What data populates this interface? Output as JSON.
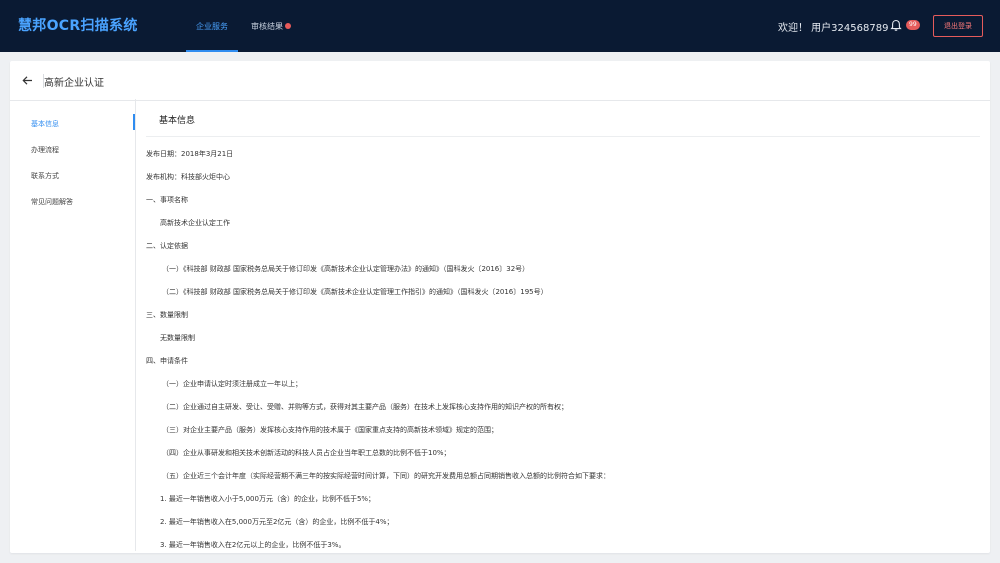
{
  "app": {
    "title": "慧邦OCR扫描系统"
  },
  "nav": {
    "tabs": [
      {
        "label": "企业服务"
      },
      {
        "label": "审核结果"
      }
    ]
  },
  "user": {
    "welcome": "欢迎！ 用户324568789",
    "notifications": "99",
    "logout_label": "退出登录"
  },
  "page": {
    "title": "高新企业认证"
  },
  "sidebar": {
    "items": [
      {
        "label": "基本信息"
      },
      {
        "label": "办理流程"
      },
      {
        "label": "联系方式"
      },
      {
        "label": "常见问题解答"
      }
    ]
  },
  "content": {
    "section_title": "基本信息",
    "lines": [
      "发布日期：2018年3月21日",
      "发布机构：科技部火炬中心",
      "一、事项名称",
      "高新技术企业认定工作",
      "二、认定依据",
      "（一）《科技部  财政部  国家税务总局关于修订印发《高新技术企业认定管理办法》的通知》（国科发火〔2016〕32号）",
      "（二）《科技部  财政部  国家税务总局关于修订印发《高新技术企业认定管理工作指引》的通知》（国科发火〔2016〕195号）",
      "三、数量限制",
      "无数量限制",
      "四、申请条件",
      "（一）企业申请认定时须注册成立一年以上；",
      "（二）企业通过自主研发、受让、受赠、并购等方式，获得对其主要产品（服务）在技术上发挥核心支持作用的知识产权的所有权；",
      "（三）对企业主要产品（服务）发挥核心支持作用的技术属于《国家重点支持的高新技术领域》规定的范围；",
      "（四）企业从事研发和相关技术创新活动的科技人员占企业当年职工总数的比例不低于10%；",
      "（五）企业近三个会计年度（实际经营期不满三年的按实际经营时间计算，下同）的研究开发费用总额占同期销售收入总额的比例符合如下要求：",
      "1. 最近一年销售收入小于5,000万元（含）的企业，比例不低于5%；",
      "2. 最近一年销售收入在5,000万元至2亿元（含）的企业，比例不低于4%；",
      "3. 最近一年销售收入在2亿元以上的企业，比例不低于3%。"
    ]
  }
}
